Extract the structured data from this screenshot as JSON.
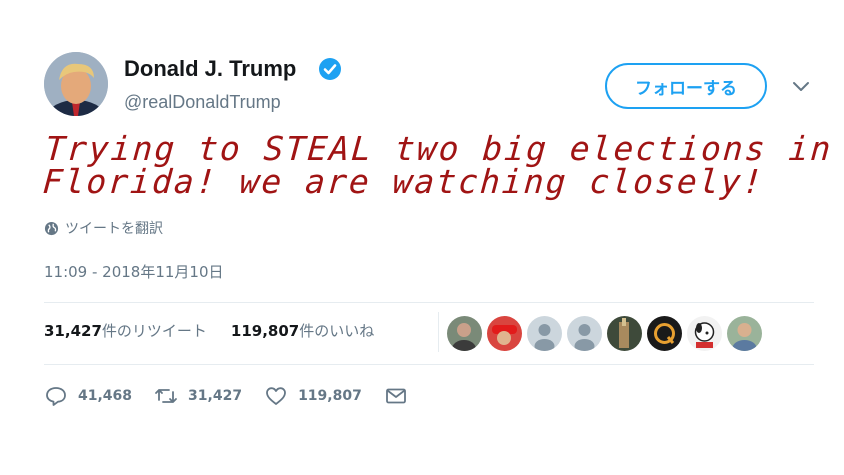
{
  "author": {
    "display_name": "Donald J. Trump",
    "handle": "@realDonaldTrump",
    "verified": true
  },
  "follow_label": "フォローする",
  "tweet_text_lines": [
    "Trying to STEAL two big elections in",
    "Florida! we are watching closely!"
  ],
  "translate_label": "ツイートを翻訳",
  "timestamp": "11:09 - 2018年11月10日",
  "stats": {
    "retweets_count": "31,427",
    "retweets_label": "件のリツイート",
    "likes_count": "119,807",
    "likes_label": "件のいいね"
  },
  "liker_avatars": [
    "photo",
    "red-hat",
    "default",
    "default",
    "photo",
    "letter-q",
    "cartoon",
    "photo"
  ],
  "actions": {
    "replies": "41,468",
    "retweets": "31,427",
    "likes": "119,807"
  },
  "icons": [
    "verified-icon",
    "caret-down-icon",
    "globe-icon",
    "reply-icon",
    "retweet-icon",
    "heart-icon",
    "mail-icon"
  ],
  "colors": {
    "accent": "#1da1f2",
    "text_secondary": "#657786",
    "tweet_text": "#a01414"
  }
}
